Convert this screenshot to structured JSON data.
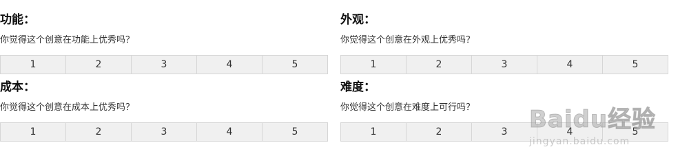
{
  "criteria": [
    {
      "title": "功能：",
      "question": "你觉得这个创意在功能上优秀吗？",
      "options": [
        "1",
        "2",
        "3",
        "4",
        "5"
      ]
    },
    {
      "title": "外观：",
      "question": "你觉得这个创意在外观上优秀吗？",
      "options": [
        "1",
        "2",
        "3",
        "4",
        "5"
      ]
    },
    {
      "title": "成本：",
      "question": "你觉得这个创意在成本上优秀吗？",
      "options": [
        "1",
        "2",
        "3",
        "4",
        "5"
      ]
    },
    {
      "title": "难度：",
      "question": "你觉得这个创意在难度上可行吗？",
      "options": [
        "1",
        "2",
        "3",
        "4",
        "5"
      ]
    }
  ],
  "watermark": {
    "main": "Baidu经验",
    "sub": "jingyan.baidu.com"
  },
  "colors": {
    "scale_bg": "#f0f0f0",
    "scale_border": "#d6d6d6",
    "watermark": "#aaaaaa"
  }
}
